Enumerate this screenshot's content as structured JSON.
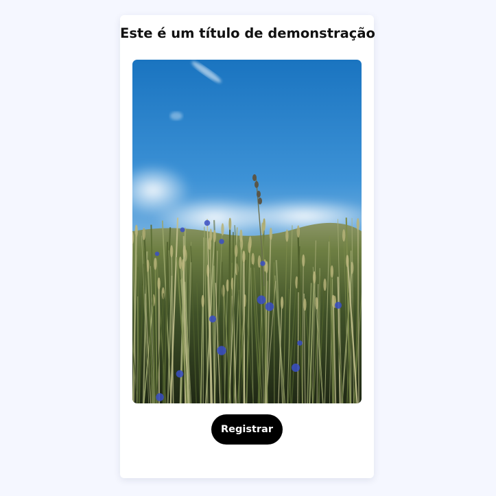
{
  "card": {
    "title": "Este é um título de demonstração",
    "image": {
      "subject": "wheat field with blue cornflowers under a blue sky",
      "colors": {
        "sky_top": "#1f7cc6",
        "sky_mid": "#4d9bd8",
        "cloud": "#e6eef5",
        "field_dark": "#2d3a1e",
        "field_light": "#7b8a4a",
        "flower": "#3a4fc4"
      }
    },
    "button_label": "Registrar"
  },
  "theme": {
    "page_background": "#f5f7ff",
    "card_background": "#ffffff",
    "button_background": "#000000",
    "button_text": "#ffffff"
  }
}
